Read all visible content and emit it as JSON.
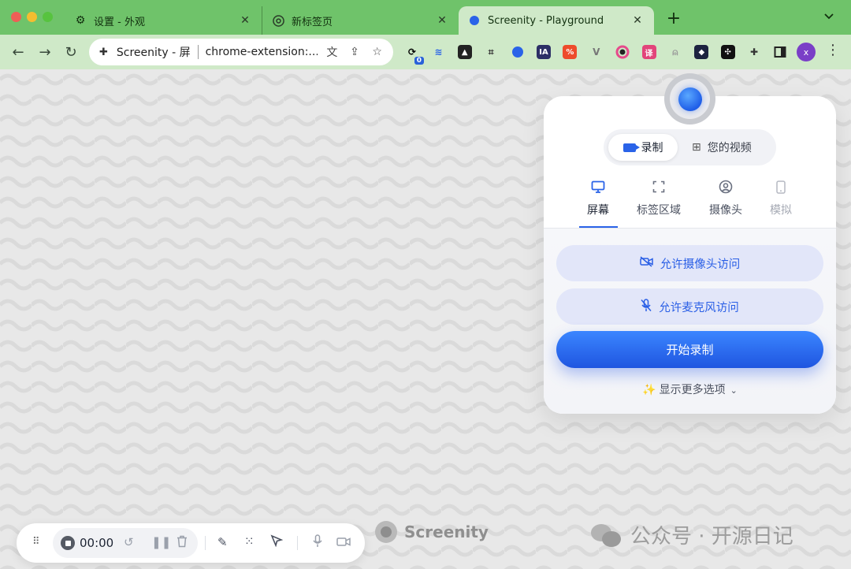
{
  "browser": {
    "tabs": [
      {
        "title": "设置 - 外观",
        "icon": "gear-icon"
      },
      {
        "title": "新标签页",
        "icon": "chrome-icon"
      },
      {
        "title": "Screenity - Playground",
        "icon": "screenity-dot-icon",
        "active": true
      }
    ],
    "new_tab_symbol": "+",
    "tab_list_symbol": "⌄",
    "address": {
      "site_name": "Screenity - 屏",
      "url": "chrome-extension:..."
    },
    "extension_badge": "0",
    "profile_initial": "x"
  },
  "popup": {
    "segments": {
      "record_label": "录制",
      "videos_label": "您的视频"
    },
    "mode_tabs": [
      {
        "label": "屏幕",
        "icon": "monitor-icon",
        "state": "active"
      },
      {
        "label": "标签区域",
        "icon": "region-icon",
        "state": "normal"
      },
      {
        "label": "摄像头",
        "icon": "camera-user-icon",
        "state": "normal"
      },
      {
        "label": "模拟",
        "icon": "phone-icon",
        "state": "disabled"
      }
    ],
    "allow_camera_label": "允许摄像头访问",
    "allow_mic_label": "允许麦克风访问",
    "start_label": "开始录制",
    "more_options_label": "显示更多选项"
  },
  "recorder_bar": {
    "time": "00:00"
  },
  "brand": {
    "name": "Screenity",
    "accent": "#2a63e8"
  },
  "watermark": {
    "text": "公众号 · 开源日记"
  }
}
